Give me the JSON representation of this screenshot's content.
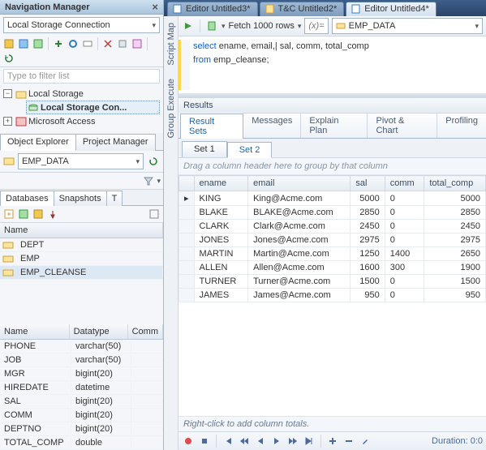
{
  "nav": {
    "title": "Navigation Manager",
    "close_glyph": "×",
    "connection": "Local Storage Connection",
    "filter_placeholder": "Type to filter list",
    "tree": {
      "local_storage": "Local Storage",
      "local_storage_con": "Local Storage Con...",
      "ms_access": "Microsoft Access"
    },
    "tabs": {
      "obj": "Object Explorer",
      "proj": "Project Manager"
    },
    "object_combo": "EMP_DATA",
    "db_tabs": {
      "db": "Databases",
      "snap": "Snapshots",
      "t": "T"
    },
    "name_hdr": "Name",
    "db_items": [
      "DEPT",
      "EMP",
      "EMP_CLEANSE"
    ],
    "cols_hdr": {
      "name": "Name",
      "datatype": "Datatype",
      "comm": "Comm"
    },
    "cols": [
      {
        "n": "PHONE",
        "t": "varchar(50)"
      },
      {
        "n": "JOB",
        "t": "varchar(50)"
      },
      {
        "n": "MGR",
        "t": "bigint(20)"
      },
      {
        "n": "HIREDATE",
        "t": "datetime"
      },
      {
        "n": "SAL",
        "t": "bigint(20)"
      },
      {
        "n": "COMM",
        "t": "bigint(20)"
      },
      {
        "n": "DEPTNO",
        "t": "bigint(20)"
      },
      {
        "n": "TOTAL_COMP",
        "t": "double"
      }
    ]
  },
  "editor_tabs": [
    {
      "label": "Editor Untitled3*"
    },
    {
      "label": "T&C  Untitled2*"
    },
    {
      "label": "Editor Untitled4*"
    }
  ],
  "vstrip": {
    "a": "Script Map",
    "b": "Group Execute"
  },
  "ed_tool": {
    "fetch": "Fetch 1000 rows",
    "var": "(x)=",
    "combo": "EMP_DATA"
  },
  "sql": {
    "l1a": "select ",
    "l1b": "ename, email,| sal, comm, total_comp",
    "l2a": "from ",
    "l2b": "emp_cleanse;"
  },
  "results": {
    "title": "Results",
    "tabs": [
      "Result Sets",
      "Messages",
      "Explain Plan",
      "Pivot & Chart",
      "Profiling"
    ],
    "sets": [
      "Set 1",
      "Set 2"
    ],
    "grouphint": "Drag a column header here to group by that column",
    "headers": [
      "ename",
      "email",
      "sal",
      "comm",
      "total_comp"
    ],
    "rows": [
      {
        "e": "KING",
        "m": "King@Acme.com",
        "s": "5000",
        "c": "0",
        "t": "5000"
      },
      {
        "e": "BLAKE",
        "m": "BLAKE@Acme.com",
        "s": "2850",
        "c": "0",
        "t": "2850"
      },
      {
        "e": "CLARK",
        "m": "Clark@Acme.com",
        "s": "2450",
        "c": "0",
        "t": "2450"
      },
      {
        "e": "JONES",
        "m": "Jones@Acme.com",
        "s": "2975",
        "c": "0",
        "t": "2975"
      },
      {
        "e": "MARTIN",
        "m": "Martin@Acme.com",
        "s": "1250",
        "c": "1400",
        "t": "2650"
      },
      {
        "e": "ALLEN",
        "m": "Allen@Acme.com",
        "s": "1600",
        "c": "300",
        "t": "1900"
      },
      {
        "e": "TURNER",
        "m": "Turner@Acme.com",
        "s": "1500",
        "c": "0",
        "t": "1500"
      },
      {
        "e": "JAMES",
        "m": "James@Acme.com",
        "s": "950",
        "c": "0",
        "t": "950"
      }
    ],
    "footer": "Right-click to add column totals.",
    "duration": "Duration: 0:0"
  }
}
